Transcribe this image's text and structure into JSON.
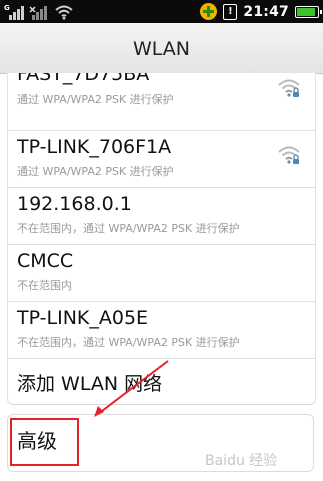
{
  "status_bar": {
    "time": "21:47",
    "signal_label": "G",
    "alert_glyph": "!",
    "icons": [
      "signal-icon",
      "no-signal-icon",
      "wifi-status-icon",
      "plus-badge-icon",
      "alert-icon",
      "battery-icon"
    ],
    "battery_level": 0.85
  },
  "title": "WLAN",
  "networks": [
    {
      "name": "FAST_7D75BA",
      "status": "通过 WPA/WPA2 PSK 进行保护",
      "icon": "wifi-locked-icon"
    },
    {
      "name": "TP-LINK_706F1A",
      "status": "通过 WPA/WPA2 PSK 进行保护",
      "icon": "wifi-locked-icon"
    },
    {
      "name": "192.168.0.1",
      "status": "不在范围内，通过 WPA/WPA2 PSK 进行保护"
    },
    {
      "name": "CMCC",
      "status": "不在范围内"
    },
    {
      "name": "TP-LINK_A05E",
      "status": "不在范围内，通过 WPA/WPA2 PSK 进行保护"
    }
  ],
  "add_network_label": "添加 WLAN 网络",
  "advanced_label": "高级",
  "annotation": {
    "highlight_color": "#e5212a"
  },
  "watermark": "Baidu 经验"
}
